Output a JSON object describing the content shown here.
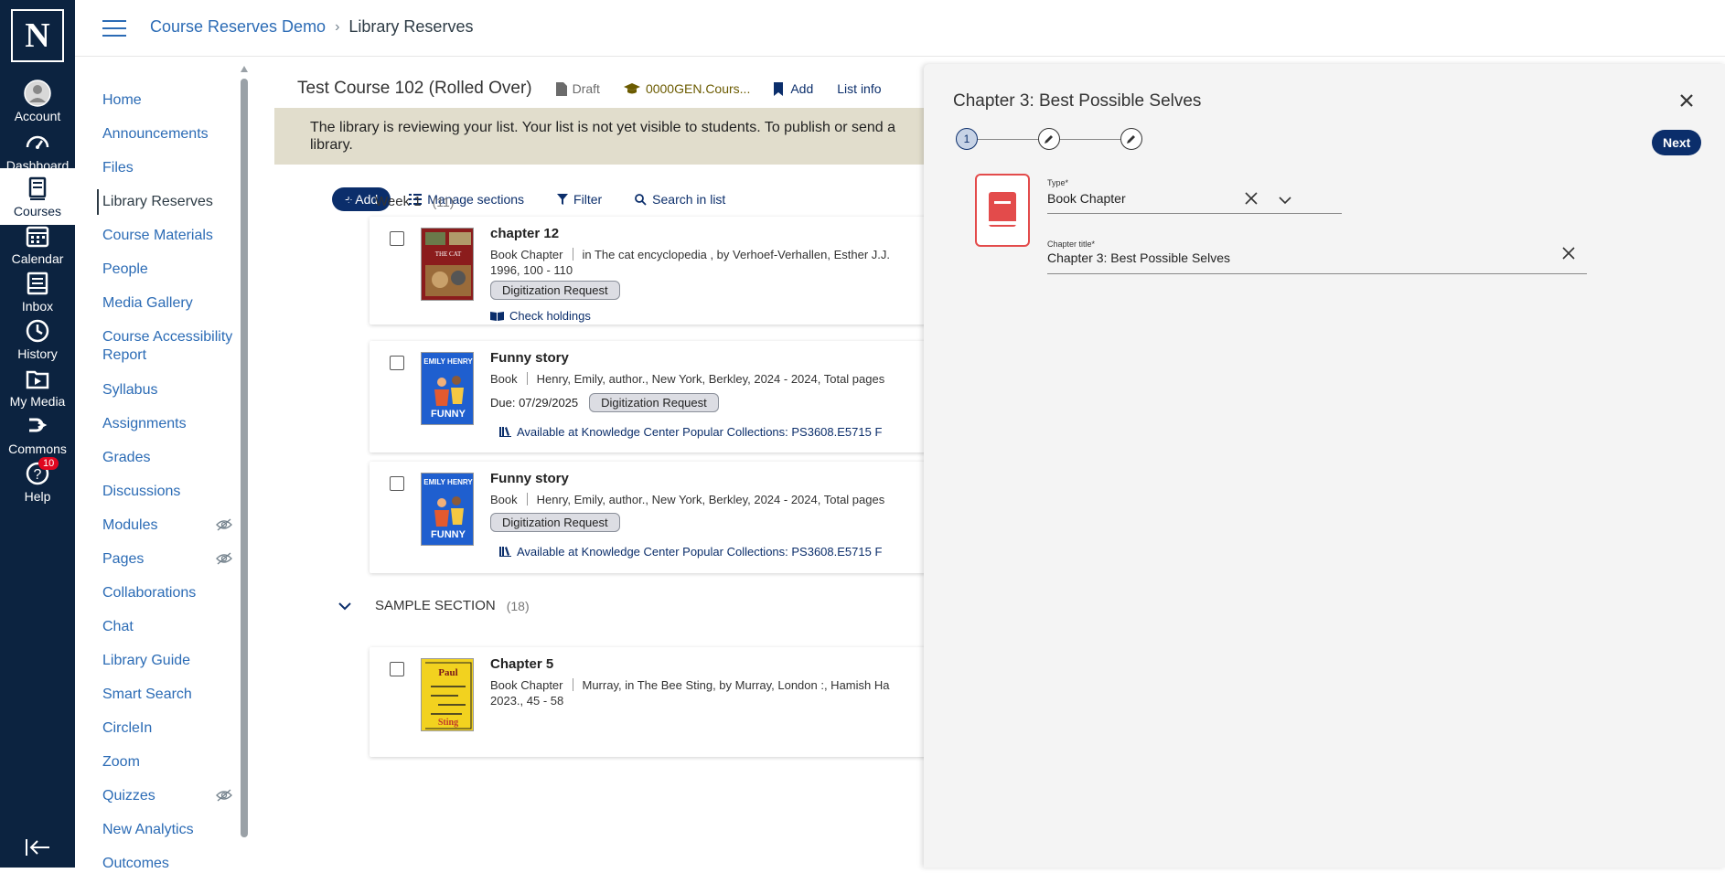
{
  "global_nav": {
    "logo": "N",
    "items": [
      {
        "label": "Account",
        "icon": "account-icon"
      },
      {
        "label": "Dashboard",
        "icon": "dashboard-icon"
      },
      {
        "label": "Courses",
        "icon": "courses-icon"
      },
      {
        "label": "Calendar",
        "icon": "calendar-icon"
      },
      {
        "label": "Inbox",
        "icon": "inbox-icon"
      },
      {
        "label": "History",
        "icon": "history-icon"
      },
      {
        "label": "My Media",
        "icon": "my-media-icon"
      },
      {
        "label": "Commons",
        "icon": "commons-icon"
      },
      {
        "label": "Help",
        "icon": "help-icon",
        "badge": "10"
      }
    ]
  },
  "breadcrumb": {
    "course": "Course Reserves Demo",
    "separator": "›",
    "page": "Library Reserves"
  },
  "course_nav": {
    "items": [
      "Home",
      "Announcements",
      "Files",
      "Library Reserves",
      "Course Materials",
      "People",
      "Media Gallery",
      "Course Accessibility Report",
      "Syllabus",
      "Assignments",
      "Grades",
      "Discussions",
      "Modules",
      "Pages",
      "Collaborations",
      "Chat",
      "Library Guide",
      "Smart Search",
      "CircleIn",
      "Zoom",
      "Quizzes",
      "New Analytics",
      "Outcomes"
    ]
  },
  "list_header": {
    "course_title": "Test Course 102 (Rolled Over)",
    "status": "Draft",
    "course_code": "0000GEN.Cours...",
    "add": "Add",
    "list_info": "List info"
  },
  "banner": {
    "text": "The library is reviewing your list. Your list is not yet visible to students. To publish or send a library."
  },
  "toolbar": {
    "add": "+ Add",
    "manage_sections": "Manage sections",
    "filter": "Filter",
    "search": "Search in list"
  },
  "sections": [
    {
      "name": "Week 1",
      "count": "(11)"
    },
    {
      "name": "SAMPLE SECTION",
      "count": "(18)"
    }
  ],
  "items": [
    {
      "title": "chapter 12",
      "type": "Book Chapter",
      "details": "in The cat encyclopedia , by Verhoef-Verhallen, Esther J.J.",
      "details2": "1996, 100 - 110",
      "tag": "Digitization Request",
      "link": "Check holdings",
      "cover_text": "THE CAT ENCYCLOPEDIA"
    },
    {
      "title": "Funny story",
      "type": "Book",
      "details": "Henry, Emily, author., New York, Berkley, 2024 - 2024, Total pages",
      "due": "Due: 07/29/2025",
      "tag": "Digitization Request",
      "link": "Available at Knowledge Center Popular Collections: PS3608.E5715 F",
      "cover_text": "EMILY HENRY FUNNY STORY"
    },
    {
      "title": "Funny story",
      "type": "Book",
      "details": "Henry, Emily, author., New York, Berkley, 2024 - 2024, Total pages",
      "tag": "Digitization Request",
      "link": "Available at Knowledge Center Popular Collections: PS3608.E5715 F",
      "cover_text": "EMILY HENRY FUNNY STORY"
    },
    {
      "title": "Chapter 5",
      "type": "Book Chapter",
      "details": "Murray, in The Bee Sting, by Murray, London :, Hamish Ha",
      "details2": "2023., 45 - 58",
      "cover_text": "Paul Murray The Bee Sting"
    }
  ],
  "panel": {
    "title": "Chapter 3: Best Possible Selves",
    "steps": [
      "1"
    ],
    "next": "Next",
    "type_label": "Type*",
    "type_value": "Book Chapter",
    "chapter_title_label": "Chapter title*",
    "chapter_title_value": "Chapter 3: Best Possible Selves"
  },
  "colors": {
    "nav_bg": "#0c2340",
    "link": "#2b6bb5",
    "primary": "#0b2e6b",
    "banner_bg": "#e1ddcc",
    "type_accent": "#e34b4b"
  }
}
